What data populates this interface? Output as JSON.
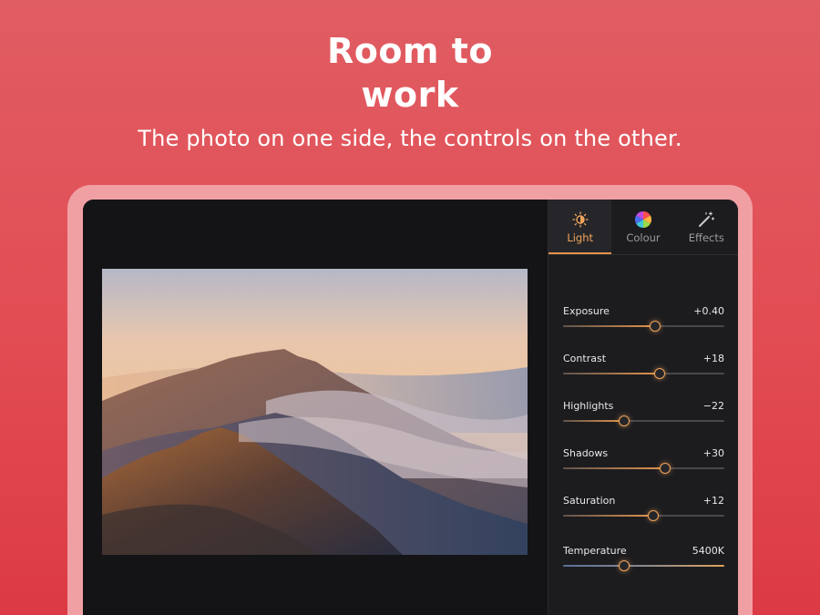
{
  "hero": {
    "title_line1": "Room to",
    "title_line2": "work",
    "subtitle": "The photo on one side, the controls on the other."
  },
  "tabs": [
    {
      "label": "Light",
      "icon": "sun-half-icon",
      "active": true
    },
    {
      "label": "Colour",
      "icon": "colour-wheel-icon",
      "active": false
    },
    {
      "label": "Effects",
      "icon": "magic-wand-icon",
      "active": false
    }
  ],
  "sliders": [
    {
      "label": "Exposure",
      "value": "+0.40",
      "level": 0.57
    },
    {
      "label": "Contrast",
      "value": "+18",
      "level": 0.6
    },
    {
      "label": "Highlights",
      "value": "−22",
      "level": 0.38
    },
    {
      "label": "Shadows",
      "value": "+30",
      "level": 0.63
    },
    {
      "label": "Saturation",
      "value": "+12",
      "level": 0.56
    },
    {
      "label": "Temperature",
      "value": "5400K",
      "level": 0.38
    }
  ],
  "colors": {
    "background": "#e24c53",
    "accent": "#e5944a",
    "panel": "#1c1c1f"
  }
}
